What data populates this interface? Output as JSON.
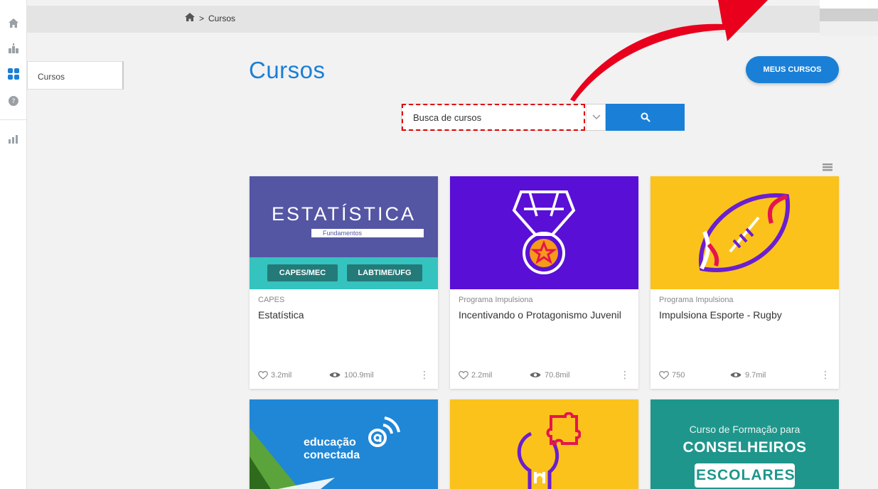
{
  "breadcrumb": {
    "current": "Cursos",
    "separator": ">"
  },
  "sidebar": {
    "selected_label": "Cursos"
  },
  "page": {
    "title": "Cursos",
    "my_courses_label": "MEUS CURSOS"
  },
  "search": {
    "placeholder": "Busca de cursos"
  },
  "colors": {
    "accent": "#1a7fd6",
    "highlight": "#e00000"
  },
  "cards": [
    {
      "category": "CAPES",
      "title": "Estatística",
      "likes": "3.2mil",
      "views": "100.9mil",
      "image": {
        "heading": "ESTATÍSTICA",
        "subheading": "Fundamentos",
        "tags": [
          "CAPES/MEC",
          "LABTIME/UFG"
        ]
      }
    },
    {
      "category": "Programa Impulsiona",
      "title": "Incentivando o Protagonismo Juvenil",
      "likes": "2.2mil",
      "views": "70.8mil"
    },
    {
      "category": "Programa Impulsiona",
      "title": "Impulsiona Esporte - Rugby",
      "likes": "750",
      "views": "9.7mil"
    },
    {
      "image": {
        "line1": "educação",
        "line2": "conectada"
      }
    },
    {},
    {
      "image": {
        "line1": "Curso de Formação para",
        "line2": "CONSELHEIROS",
        "line3": "ESCOLARES"
      }
    }
  ]
}
